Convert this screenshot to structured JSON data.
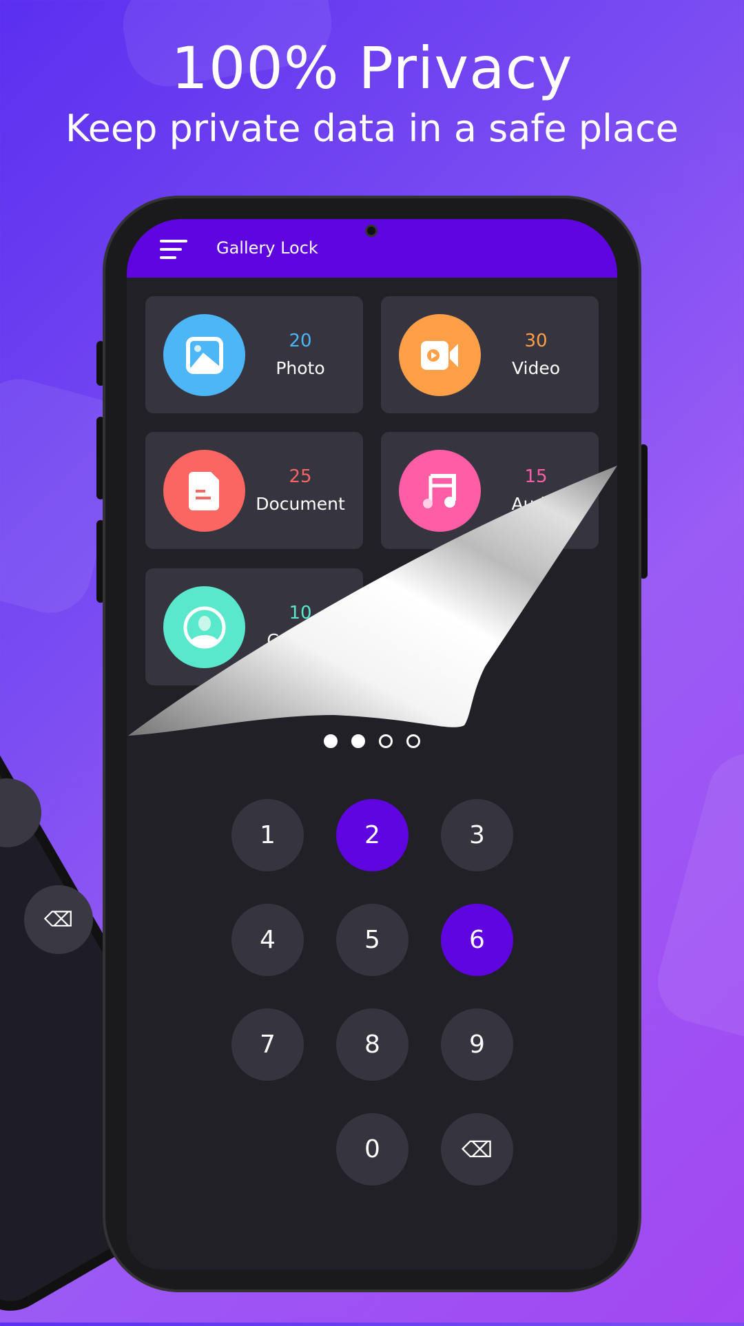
{
  "hero": {
    "title": "100% Privacy",
    "subtitle": "Keep private data in a safe place"
  },
  "app": {
    "title": "Gallery Lock"
  },
  "categories": [
    {
      "count": "20",
      "label": "Photo",
      "color": "#4db6f7",
      "icon": "image-icon"
    },
    {
      "count": "30",
      "label": "Video",
      "color": "#ffa048",
      "icon": "video-camera-icon"
    },
    {
      "count": "25",
      "label": "Document",
      "color": "#fb6562",
      "icon": "document-icon"
    },
    {
      "count": "15",
      "label": "Audio",
      "color": "#ff5ea6",
      "icon": "music-note-icon"
    },
    {
      "count": "10",
      "label": "Contact",
      "color": "#5ae8cc",
      "icon": "contact-icon"
    }
  ],
  "page_indicator": {
    "total": 4,
    "filled": 2
  },
  "keypad": {
    "keys": [
      "1",
      "2",
      "3",
      "4",
      "5",
      "6",
      "7",
      "8",
      "9",
      "0"
    ],
    "pressed": [
      "2",
      "6"
    ],
    "accent": "#5f05e0"
  }
}
